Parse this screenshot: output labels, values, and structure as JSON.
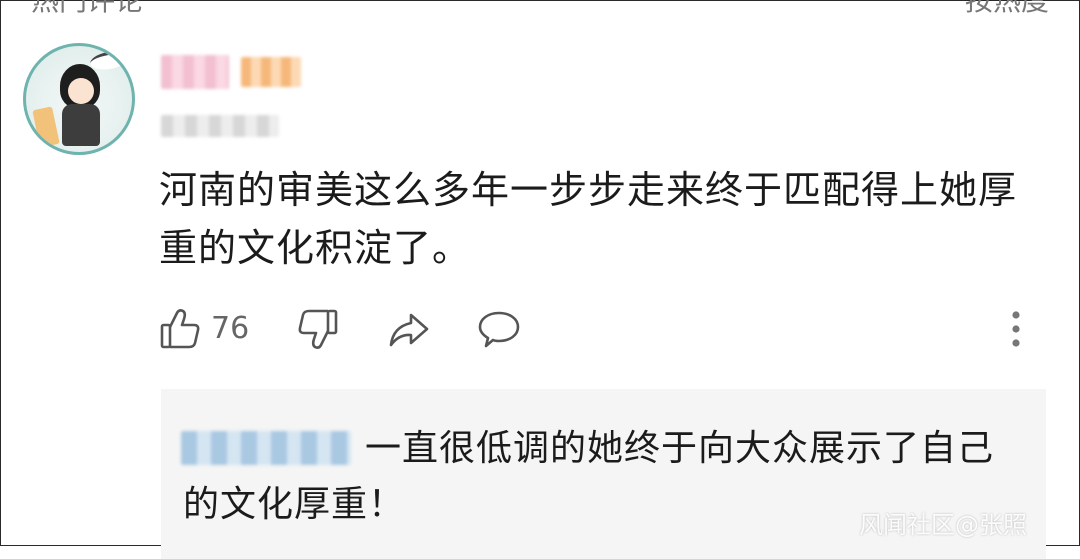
{
  "header": {
    "title": "热门评论",
    "sort": "按热度"
  },
  "comment": {
    "username": "",
    "meta": "",
    "text": "河南的审美这么多年一步步走来终于匹配得上她厚重的文化积淀了。",
    "like_count": "76"
  },
  "icons": {
    "like": "thumbs-up-icon",
    "dislike": "thumbs-down-icon",
    "share": "share-arrow-icon",
    "reply": "speech-bubble-icon",
    "more": "more-vertical-icon"
  },
  "reply": {
    "username": "",
    "text": "一直很低调的她终于向大众展示了自己的文化厚重！"
  },
  "watermark": "风闻社区@张照"
}
